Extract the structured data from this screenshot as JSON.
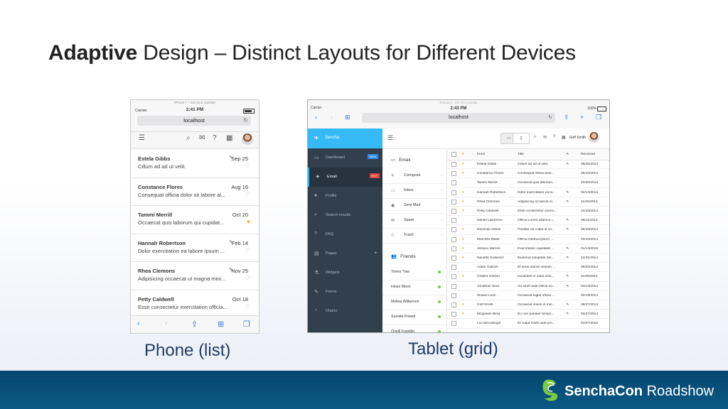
{
  "slide": {
    "title_bold": "Adaptive",
    "title_rest": " Design – Distinct Layouts for Different Devices",
    "caption_phone": "Phone (list)",
    "caption_tablet": "Tablet (grid)",
    "footer_brand_bold": "SenchaCon",
    "footer_brand_rest": " Roadshow"
  },
  "phone": {
    "carrier": "Carrier",
    "sim_label": "iPhone 7 – iOS 10.2 (14C89)",
    "time": "2:41 PM",
    "url": "localhost",
    "emails": [
      {
        "name": "Estela Gibbs",
        "date": "Sep 25",
        "subject": "Cillum ad ad ut velit.",
        "attach": true,
        "fav": false
      },
      {
        "name": "Constance Flores",
        "date": "Aug 16",
        "subject": "Consequat officia dolor sit labore al...",
        "attach": false,
        "fav": false
      },
      {
        "name": "Tammi Merrill",
        "date": "Oct 20",
        "subject": "Occaecat quis laborum qui cupidat...",
        "attach": false,
        "fav": true
      },
      {
        "name": "Hannah Robertson",
        "date": "Feb 14",
        "subject": "Dolor exercitation ea labore ipsum ...",
        "attach": true,
        "fav": false
      },
      {
        "name": "Rhea Clemons",
        "date": "Nov 25",
        "subject": "Adipisicing occaecat ut magna mini...",
        "attach": true,
        "fav": false
      },
      {
        "name": "Petty Caldwell",
        "date": "Oct 18",
        "subject": "Esse consectetur exercitation officia...",
        "attach": false,
        "fav": false
      }
    ]
  },
  "tablet": {
    "carrier": "Carrier",
    "sim_label": "iPad Air 2 – iOS 10.2 (14C89)",
    "time": "2:43 PM",
    "battery": "100%",
    "url": "localhost",
    "brand": "Sencha",
    "user": "Goff Smith",
    "nav": [
      {
        "label": "Dashboard",
        "icon": "▭",
        "badge": "NEW",
        "badge_color": "#2e8fe0"
      },
      {
        "label": "Email",
        "icon": "✈",
        "badge": "HOT",
        "badge_color": "#e0453a",
        "active": true
      },
      {
        "label": "Profile",
        "icon": "●"
      },
      {
        "label": "Search results",
        "icon": "⌕"
      },
      {
        "label": "FAQ",
        "icon": "?"
      },
      {
        "label": "Pages",
        "icon": "▤",
        "arrow": "▸"
      },
      {
        "label": "Widgets",
        "icon": "⚗"
      },
      {
        "label": "Forms",
        "icon": "✎"
      },
      {
        "label": "Charts",
        "icon": "◔"
      }
    ],
    "email_menu_title": "Email",
    "email_menu": [
      {
        "label": "Compose",
        "icon": "✎"
      },
      {
        "label": "Inbox",
        "icon": "▭"
      },
      {
        "label": "Sent Mail",
        "icon": "◉"
      },
      {
        "label": "Spam",
        "icon": "✉"
      },
      {
        "label": "Trash",
        "icon": "♲"
      }
    ],
    "friends_title": "Friends",
    "friends": [
      "Torres Tran",
      "Hines Moon",
      "Molina Wilkerson",
      "Suzette Powell",
      "Oneill Franklin"
    ],
    "grid_headers": {
      "from": "From",
      "title": "Title",
      "received": "Received"
    },
    "grid_rows": [
      {
        "from": "Estela Gibbs",
        "title": "Cillum ad ad ut velit.",
        "date": "09/25/2014",
        "fav": true,
        "attach": true
      },
      {
        "from": "Constance Flores",
        "title": "Consequat officia dolo...",
        "date": "08/16/2014",
        "fav": true,
        "attach": false
      },
      {
        "from": "Tammi Merrill",
        "title": "Occaecat quis laborum...",
        "date": "10/20/2014",
        "fav": false,
        "attach": false
      },
      {
        "from": "Hannah Robertson",
        "title": "Dolor exercitation ea la...",
        "date": "02/14/2014",
        "fav": true,
        "attach": true
      },
      {
        "from": "Rhea Clemons",
        "title": "Adipisicing occaecat ut ...",
        "date": "11/25/2014",
        "fav": true,
        "attach": true
      },
      {
        "from": "Petty Caldwell",
        "title": "Esse consectetur exerci...",
        "date": "10/18/2014",
        "fav": true,
        "attach": false
      },
      {
        "from": "Daniel Lawrence",
        "title": "Officia Lorem ullamco i...",
        "date": "09/11/2014",
        "fav": false,
        "attach": true
      },
      {
        "from": "Newman Atkins",
        "title": "Pariatur ea culpa ut ve...",
        "date": "05/15/2014",
        "fav": true,
        "attach": true
      },
      {
        "from": "Marcella Wade",
        "title": "Officia nostrud ipsum ...",
        "date": "02/10/2014",
        "fav": true,
        "attach": false
      },
      {
        "from": "Jessica Warren",
        "title": "Exercitation cupidatat ...",
        "date": "01/14/2015",
        "fav": true,
        "attach": true
      },
      {
        "from": "Nanette Gutierrez",
        "title": "Eiusmod voluptate dol...",
        "date": "12/31/2014",
        "fav": true,
        "attach": true
      },
      {
        "from": "Adam Gulliver",
        "title": "Et amet dolore veniam ...",
        "date": "05/02/2014",
        "fav": false,
        "attach": false
      },
      {
        "from": "Chakra Gibson",
        "title": "Incididunt in nulla dolo...",
        "date": "11/09/2014",
        "fav": true,
        "attach": true
      },
      {
        "from": "Jonathan Soul",
        "title": "Ad amet aute officia no...",
        "date": "04/13/2014",
        "fav": false,
        "attach": true
      },
      {
        "from": "Shawn Leon",
        "title": "Occaecat fugiat officia ...",
        "date": "02/19/2014",
        "fav": false,
        "attach": false
      },
      {
        "from": "Goff Smith",
        "title": "Occaecat minim in min...",
        "date": "06/27/2014",
        "fav": true,
        "attach": true
      },
      {
        "from": "Mcgowan Berg",
        "title": "Eu non pariatur tempo...",
        "date": "02/27/2014",
        "fav": true,
        "attach": true
      },
      {
        "from": "Luz Mccullough",
        "title": "Et culpa mollit aute pro...",
        "date": "02/07/2015",
        "fav": false,
        "attach": false
      }
    ]
  },
  "icons": {
    "fav_on": "♥",
    "fav_off": "♡",
    "attach": "✎"
  },
  "colors": {
    "accent": "#35baf6",
    "sidebar": "#32404e",
    "fav": "#f0a81c",
    "footer": "#06456d"
  }
}
